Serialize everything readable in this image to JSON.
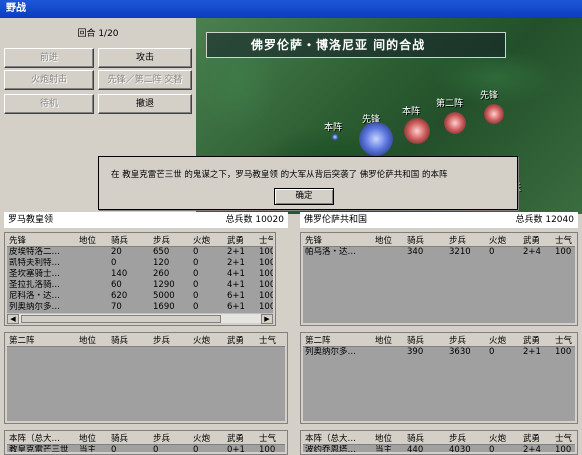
{
  "window": {
    "title": "野战"
  },
  "controls": {
    "turn": "回合 1/20",
    "buttons": [
      {
        "id": "advance",
        "label": "前进",
        "enabled": false
      },
      {
        "id": "attack",
        "label": "攻击",
        "enabled": true
      },
      {
        "id": "cannon",
        "label": "火炮射击",
        "enabled": false
      },
      {
        "id": "swap",
        "label": "先锋／第二阵 交替",
        "enabled": false
      },
      {
        "id": "standby",
        "label": "待机",
        "enabled": false
      },
      {
        "id": "retreat",
        "label": "撤退",
        "enabled": true
      }
    ]
  },
  "map": {
    "banner": "佛罗伦萨・博洛尼亚 间的合战",
    "labels": [
      "本阵",
      "先锋",
      "本阵",
      "第二阵",
      "先锋",
      "天"
    ]
  },
  "dialog": {
    "message": "在 教皇克雷芒三世 的鬼谋之下，罗马教皇领 的大军从背后突袭了 佛罗伦萨共和国 的本阵",
    "ok_label": "确定"
  },
  "left": {
    "name": "罗马教皇领",
    "total_label": "总兵数",
    "total": "10020",
    "columns_vanguard": [
      "先锋",
      "地位",
      "骑兵",
      "步兵",
      "火炮",
      "武勇",
      "士气"
    ],
    "columns_second": [
      "第二阵",
      "地位",
      "骑兵",
      "步兵",
      "火炮",
      "武勇",
      "士气"
    ],
    "columns_main": [
      "本阵（总大…",
      "地位",
      "骑兵",
      "步兵",
      "火炮",
      "武勇",
      "士气"
    ],
    "vanguard": [
      [
        "皮埃特洛二…",
        "",
        "20",
        "650",
        "0",
        "2+1",
        "100"
      ],
      [
        "凯特夫利特…",
        "",
        "0",
        "120",
        "0",
        "2+1",
        "100"
      ],
      [
        "圣坎塞骑士…",
        "",
        "140",
        "260",
        "0",
        "4+1",
        "100"
      ],
      [
        "圣拉扎洛骑…",
        "",
        "60",
        "1290",
        "0",
        "4+1",
        "100"
      ],
      [
        "尼科洛・达…",
        "",
        "620",
        "5000",
        "0",
        "6+1",
        "100"
      ],
      [
        "列奥纳尔多…",
        "",
        "70",
        "1690",
        "0",
        "6+1",
        "100"
      ]
    ],
    "second": [],
    "main": [
      [
        "教皇克雷芒三世",
        "当主",
        "0",
        "0",
        "0",
        "0+1",
        "100"
      ]
    ]
  },
  "right": {
    "name": "佛罗伦萨共和国",
    "total_label": "总兵数",
    "total": "12040",
    "columns_vanguard": [
      "先锋",
      "地位",
      "骑兵",
      "步兵",
      "火炮",
      "武勇",
      "士气"
    ],
    "columns_second": [
      "第二阵",
      "地位",
      "骑兵",
      "步兵",
      "火炮",
      "武勇",
      "士气"
    ],
    "columns_main": [
      "本阵（总大…",
      "地位",
      "骑兵",
      "步兵",
      "火炮",
      "武勇",
      "士气"
    ],
    "vanguard": [
      [
        "帕乌洛・达…",
        "",
        "340",
        "3210",
        "0",
        "2+4",
        "100"
      ]
    ],
    "second": [
      [
        "列奥纳尔多…",
        "",
        "390",
        "3630",
        "0",
        "2+1",
        "100"
      ]
    ],
    "main": [
      [
        "波约乔恩塔…",
        "当主",
        "440",
        "4030",
        "0",
        "2+4",
        "100"
      ]
    ]
  },
  "colors": {
    "title_bar": "#0a3dbf",
    "panel": "#d4d0c8",
    "table_bg": "#a0a0a0"
  }
}
